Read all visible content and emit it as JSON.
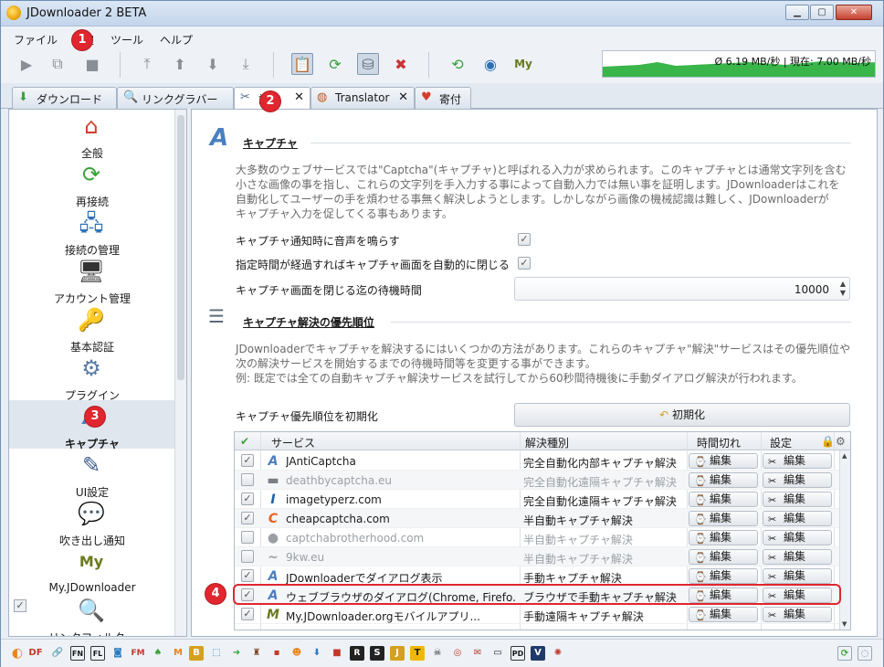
{
  "window": {
    "title": "JDownloader 2 BETA"
  },
  "menu": [
    "ファイル",
    "設定",
    "ツール",
    "ヘルプ"
  ],
  "speed_text": "Ø 6.19 MB/秒 | 現在: 7.00 MB/秒",
  "tabs": [
    {
      "label": "ダウンロード",
      "icon": "download-icon"
    },
    {
      "label": "リンクグラバー",
      "icon": "linkgrabber-icon"
    },
    {
      "label": "設定",
      "icon": "settings-icon"
    },
    {
      "label": "Translator",
      "icon": "translator-icon"
    },
    {
      "label": "寄付",
      "icon": "donate-heart-icon"
    }
  ],
  "sidebar": [
    {
      "label": "全般",
      "icon": "home-icon"
    },
    {
      "label": "再接続",
      "icon": "reconnect-icon"
    },
    {
      "label": "接続の管理",
      "icon": "connection-icon"
    },
    {
      "label": "アカウント管理",
      "icon": "account-icon"
    },
    {
      "label": "基本認証",
      "icon": "basic-auth-icon"
    },
    {
      "label": "プラグイン",
      "icon": "plugin-icon"
    },
    {
      "label": "キャプチャ",
      "icon": "captcha-icon"
    },
    {
      "label": "UI設定",
      "icon": "ui-icon"
    },
    {
      "label": "吹き出し通知",
      "icon": "bubble-icon"
    },
    {
      "label": "My.JDownloader",
      "icon": "myjd-icon"
    },
    {
      "label": "リンクフィルター",
      "icon": "linkfilter-icon"
    }
  ],
  "captcha": {
    "title": "キャプチャ",
    "desc": [
      "大多数のウェブサービスでは\"Captcha\"(キャプチャ)と呼ばれる入力が求められます。このキャプチャとは通常文字列を含む",
      "小さな画像の事を指し、これらの文字列を手入力する事によって自動入力では無い事を証明します。JDownloaderはこれを",
      "自動化してユーザーの手を煩わせる事無く解決しようとします。しかしながら画像の機械認識は難しく、JDownloaderが",
      "キャプチャ入力を促してくる事もあります。"
    ],
    "opt_sound": "キャプチャ通知時に音声を鳴らす",
    "opt_autoclose": "指定時間が経過すればキャプチャ画面を自動的に閉じる",
    "opt_wait": "キャプチャ画面を閉じる迄の待機時間",
    "wait_value": "10000"
  },
  "priority": {
    "title": "キャプチャ解決の優先順位",
    "desc": [
      "JDownloaderでキャプチャを解決するにはいくつかの方法があります。これらのキャプチャ\"解決\"サービスはその優先順位や",
      "次の解決サービスを開始するまでの待機時間等を変更する事ができます。",
      "例: 既定では全ての自動キャプチャ解決サービスを試行してから60秒間待機後に手動ダイアログ解決が行われます。"
    ],
    "reset_label": "キャプチャ優先順位を初期化",
    "reset_button": "初期化"
  },
  "table": {
    "headers": [
      "サービス",
      "解決種別",
      "時間切れ",
      "設定"
    ],
    "edit": "編集",
    "rows": [
      {
        "service": "JAntiCaptcha",
        "type": "完全自動化内部キャプチャ解決",
        "checked": true,
        "icon": "A"
      },
      {
        "service": "deathbycaptcha.eu",
        "type": "完全自動化遠隔キャプチャ解決",
        "checked": false,
        "icon": "▬"
      },
      {
        "service": "imagetyperz.com",
        "type": "完全自動化遠隔キャプチャ解決",
        "checked": true,
        "icon": "I"
      },
      {
        "service": "cheapcaptcha.com",
        "type": "半自動キャプチャ解決",
        "checked": true,
        "icon": "C"
      },
      {
        "service": "captchabrotherhood.com",
        "type": "半自動キャプチャ解決",
        "checked": false,
        "icon": "●"
      },
      {
        "service": "9kw.eu",
        "type": "半自動キャプチャ解決",
        "checked": false,
        "icon": "~"
      },
      {
        "service": "JDownloaderでダイアログ表示",
        "type": "手動キャプチャ解決",
        "checked": true,
        "icon": "A"
      },
      {
        "service": "ウェブブラウザのダイアログ(Chrome, Firefo...",
        "type": "ブラウザで手動キャプチャ解決",
        "checked": true,
        "icon": "A"
      },
      {
        "service": "My.JDownloader.orgモバイルアプリ...",
        "type": "手動遠隔キャプチャ解決",
        "checked": true,
        "icon": "M"
      }
    ]
  },
  "badges": [
    "1",
    "2",
    "3",
    "4"
  ],
  "statusbar_icons": [
    "DF",
    "FN",
    "FL",
    "FM",
    "M",
    "B",
    "R",
    "S",
    "J",
    "T",
    "PD",
    "V"
  ]
}
